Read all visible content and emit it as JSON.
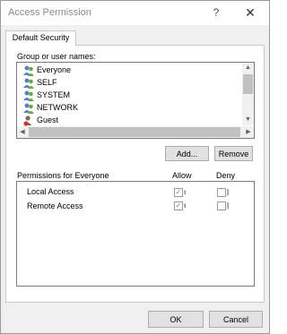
{
  "window": {
    "title": "Access Permission",
    "help_label": "?",
    "close_label": "✕"
  },
  "tab": {
    "label": "Default Security"
  },
  "groups": {
    "label": "Group or user names:",
    "items": [
      {
        "name": "Everyone",
        "icon": "users-group-icon"
      },
      {
        "name": "SELF",
        "icon": "users-group-icon"
      },
      {
        "name": "SYSTEM",
        "icon": "users-group-icon"
      },
      {
        "name": "NETWORK",
        "icon": "users-group-icon"
      },
      {
        "name": "Guest",
        "icon": "user-guest-icon"
      }
    ]
  },
  "buttons": {
    "add": "Add...",
    "remove": "Remove",
    "ok": "OK",
    "cancel": "Cancel"
  },
  "permissions": {
    "header": "Permissions for Everyone",
    "allow_header": "Allow",
    "deny_header": "Deny",
    "rows": [
      {
        "name": "Local Access",
        "allow": true,
        "deny": false
      },
      {
        "name": "Remote Access",
        "allow": true,
        "deny": false
      }
    ]
  }
}
